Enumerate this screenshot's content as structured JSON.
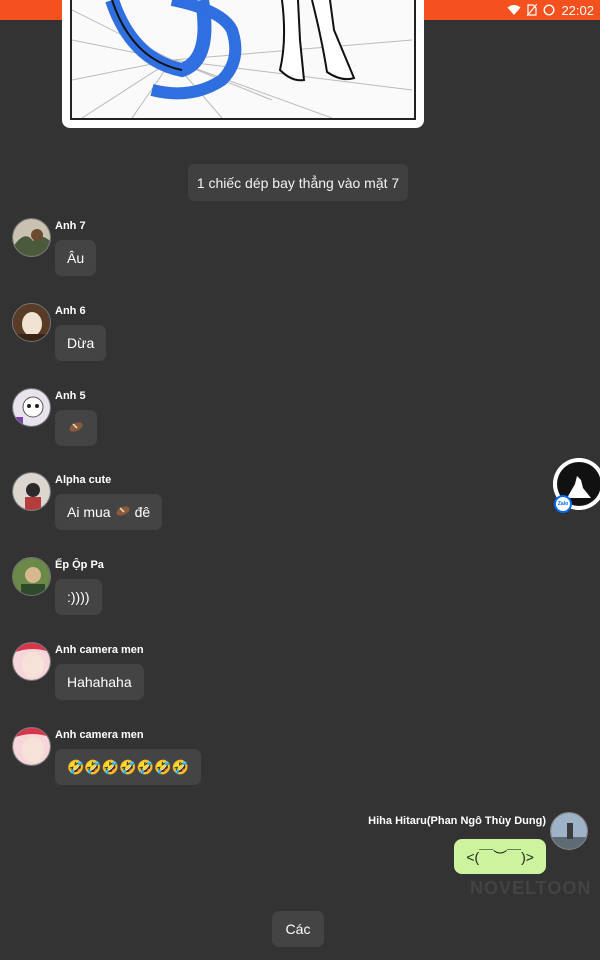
{
  "status_bar": {
    "time": "22:02",
    "icons": [
      "wifi-icon",
      "no-sim-icon",
      "sync-circle-icon"
    ]
  },
  "system_message": "1 chiếc dép bay thẳng vào mặt 7",
  "messages": [
    {
      "sender": "Anh 7",
      "text": "Âu"
    },
    {
      "sender": "Anh 6",
      "text": "Dừa"
    },
    {
      "sender": "Anh 5",
      "text": "",
      "emoji": "sandal-emoji"
    },
    {
      "sender": "Alpha cute",
      "text_before": "Ai mua",
      "emoji": "sandal-emoji",
      "text_after": "đê"
    },
    {
      "sender": "Ếp Ộp Pa",
      "text": ":))))"
    },
    {
      "sender": "Anh camera men",
      "text": "Hahahaha"
    },
    {
      "sender": "Anh camera men",
      "text": "🤣🤣🤣🤣🤣🤣🤣"
    }
  ],
  "self_message": {
    "sender": "Hiha Hitaru(Phan Ngô Thùy Dung)",
    "text": "<(￣︶￣)>"
  },
  "watermark": "NOVELTOON",
  "floating_widget": {
    "badge": "Zalo"
  },
  "bottom_button": "Các",
  "colors": {
    "status_bar": "#f4511e",
    "background": "#333333",
    "bubble": "#444444",
    "self_bubble": "#ccf39d"
  }
}
